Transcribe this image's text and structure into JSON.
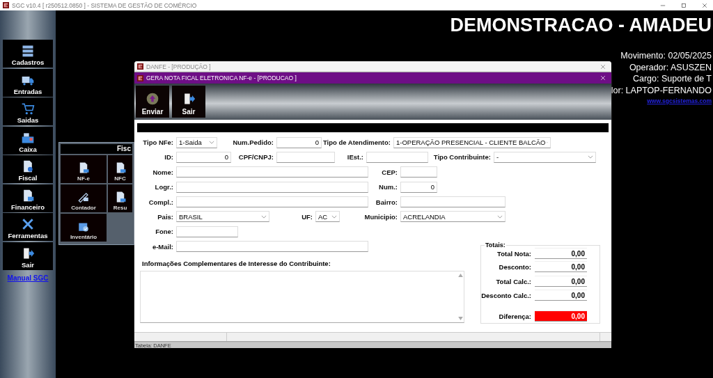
{
  "app_window": {
    "title": "SGC v10.4 [ r250512.0850 ] - SISTEMA DE GESTÃO DE COMÉRCIO"
  },
  "sidebar": {
    "items": [
      "Cadastros",
      "Entradas",
      "Saidas",
      "Caixa",
      "Fiscal",
      "Financeiro",
      "Ferramentas",
      "Sair"
    ],
    "link": "Manual SGC"
  },
  "header": {
    "company": "DEMONSTRACAO - AMADEU",
    "info": [
      "Movimento: 02/05/2025",
      "Operador: ASUSZEN",
      "Cargo: Suporte de T",
      "lor: LAPTOP-FERNANDO"
    ],
    "website": "www.sgcsistemas.com"
  },
  "fiscal_panel": {
    "title": "Fisc",
    "items": [
      "NF-e",
      "NFC",
      "Contador",
      "Resu",
      "Inventário"
    ]
  },
  "danfe_window": {
    "title": "DANFE - [PRODUÇÃO ]",
    "status": "Tabela: DANFE"
  },
  "nfe_dialog": {
    "title": "GERA NOTA FICAL ELETRONICA NF-e - [PRODUCAO ]",
    "toolbar": [
      "Enviar",
      "Sair"
    ],
    "rows": [
      [
        {
          "label": "Tipo NFe:",
          "kind": "select",
          "value": "1-Saida"
        },
        {
          "label": "Num.Pedido:",
          "kind": "text",
          "value": "0"
        },
        {
          "label": "Tipo de Atendimento:",
          "kind": "select",
          "value": "1-OPERAÇÃO PRESENCIAL - CLIENTE BALCÃO"
        }
      ],
      [
        {
          "label": "ID:",
          "kind": "text",
          "value": "0"
        },
        {
          "label": "CPF/CNPJ:",
          "kind": "text"
        },
        {
          "label": "IEst.:",
          "kind": "text"
        },
        {
          "label": "Tipo Contribuinte:",
          "kind": "select",
          "value": "-"
        }
      ],
      [
        {
          "label": "Nome:",
          "kind": "text"
        },
        {
          "label": "CEP:",
          "kind": "text"
        }
      ],
      [
        {
          "label": "Logr.:",
          "kind": "text"
        },
        {
          "label": "Num.:",
          "kind": "text",
          "value": "0"
        }
      ],
      [
        {
          "label": "Compl.:",
          "kind": "text"
        },
        {
          "label": "Bairro:",
          "kind": "text"
        }
      ],
      [
        {
          "label": "Pais:",
          "kind": "select",
          "value": "BRASIL"
        },
        {
          "label": "UF:",
          "kind": "select",
          "value": "AC"
        },
        {
          "label": "Municipio:",
          "kind": "select",
          "value": "ACRELANDIA"
        }
      ],
      [
        {
          "label": "Fone:",
          "kind": "text"
        }
      ],
      [
        {
          "label": "e-Mail:",
          "kind": "text"
        }
      ]
    ],
    "info_label": "Informações Complementares de Interesse do Contribuinte:",
    "totals": {
      "title": "Totais:",
      "rows": [
        {
          "label": "Total Nota:",
          "value": "0,00",
          "kind": "normal"
        },
        {
          "label": "Desconto:",
          "value": "0,00",
          "kind": "normal"
        },
        {
          "label": "Total Calc.:",
          "value": "0,00",
          "kind": "normal"
        },
        {
          "label": "Desconto Calc.:",
          "value": "0,00",
          "kind": "normal"
        },
        {
          "label": "Diferença:",
          "value": "0,00",
          "kind": "alert"
        }
      ]
    }
  }
}
